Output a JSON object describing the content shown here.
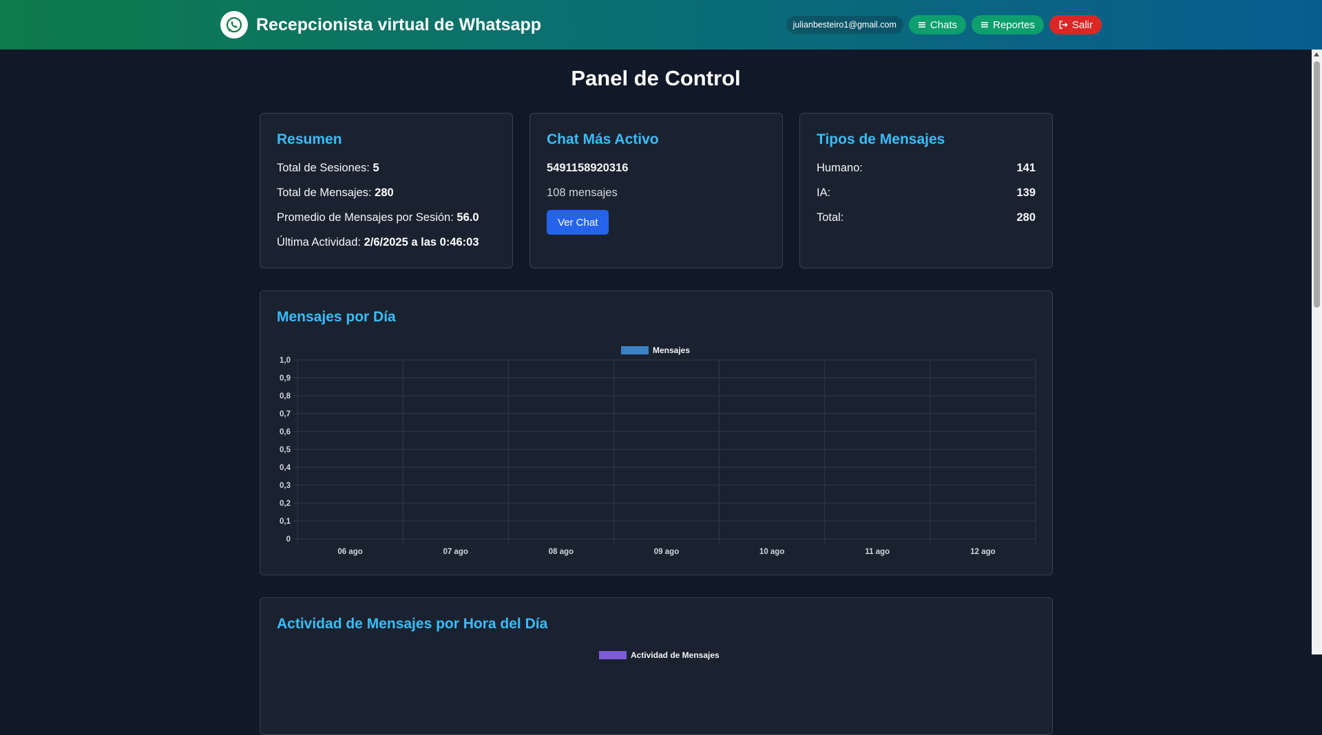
{
  "header": {
    "logo_icon": "whatsapp-icon",
    "title": "Recepcionista virtual de Whatsapp",
    "email": "julianbesteiro1@gmail.com",
    "nav": {
      "chats_label": "Chats",
      "reports_label": "Reportes",
      "logout_label": "Salir"
    }
  },
  "page": {
    "title": "Panel de Control"
  },
  "summary": {
    "title": "Resumen",
    "sessions_label": "Total de Sesiones:",
    "sessions_value": "5",
    "messages_label": "Total de Mensajes:",
    "messages_value": "280",
    "avg_label": "Promedio de Mensajes por Sesión:",
    "avg_value": "56.0",
    "last_activity_label": "Última Actividad:",
    "last_activity_value": "2/6/2025 a las 0:46:03"
  },
  "active_chat": {
    "title": "Chat Más Activo",
    "phone": "5491158920316",
    "messages": "108 mensajes",
    "button_label": "Ver Chat"
  },
  "message_types": {
    "title": "Tipos de Mensajes",
    "rows": [
      {
        "label": "Humano:",
        "value": "141"
      },
      {
        "label": "IA:",
        "value": "139"
      },
      {
        "label": "Total:",
        "value": "280"
      }
    ]
  },
  "daily_card": {
    "title": "Mensajes por Día"
  },
  "hourly_card": {
    "title": "Actividad de Mensajes por Hora del Día",
    "legend": "Actividad de Mensajes",
    "legend_color": "#7c5cd6"
  },
  "colors": {
    "accent": "#38bdf8",
    "primary_button": "#2563eb",
    "nav_green": "#0e9f6e",
    "nav_red": "#dc2626",
    "series": "#3b82c4"
  },
  "chart_data": {
    "type": "bar",
    "categories": [
      "06 ago",
      "07 ago",
      "08 ago",
      "09 ago",
      "10 ago",
      "11 ago",
      "12 ago"
    ],
    "series": [
      {
        "name": "Mensajes",
        "values": [
          0,
          0,
          0,
          0,
          0,
          0,
          0
        ]
      }
    ],
    "y_ticks": [
      "1,0",
      "0,9",
      "0,8",
      "0,7",
      "0,6",
      "0,5",
      "0,4",
      "0,3",
      "0,2",
      "0,1",
      "0"
    ],
    "ylim": [
      0,
      1
    ],
    "grid": true,
    "legend_position": "top-center"
  }
}
